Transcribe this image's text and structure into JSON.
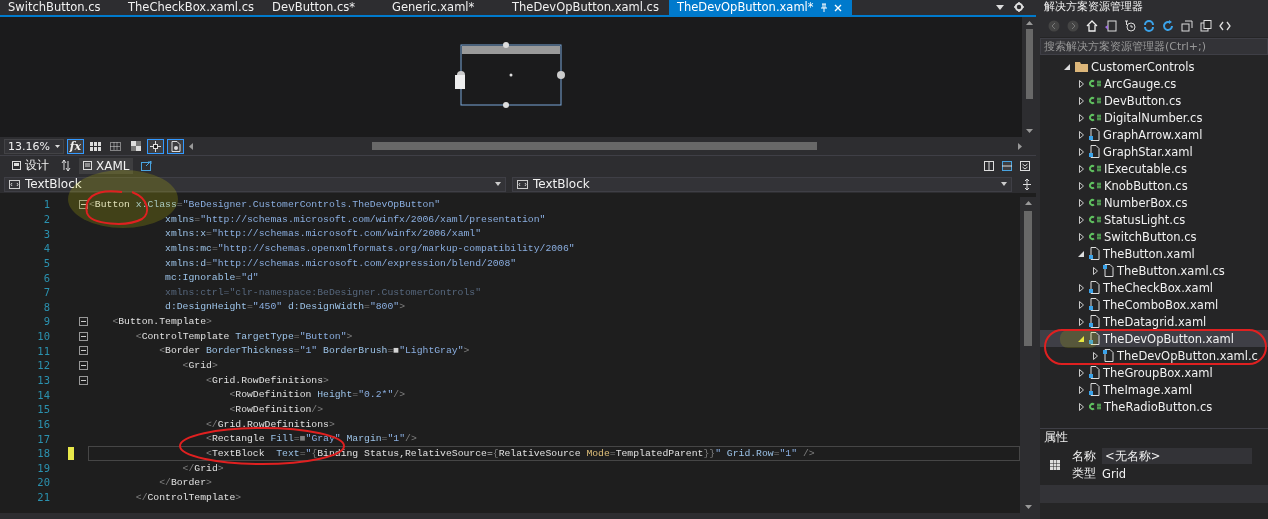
{
  "document_tabs": [
    {
      "label": "SwitchButton.cs",
      "selected": false
    },
    {
      "label": "TheCheckBox.xaml.cs",
      "selected": false
    },
    {
      "label": "DevButton.cs*",
      "selected": false
    },
    {
      "label": "Generic.xaml*",
      "selected": false
    },
    {
      "label": "TheDevOpButton.xaml.cs",
      "selected": false
    },
    {
      "label": "TheDevOpButton.xaml*",
      "selected": true
    }
  ],
  "designer": {
    "zoom": "13.16%",
    "formula_label": "fx"
  },
  "view_tabs": [
    {
      "label": "设计",
      "selected": false
    },
    {
      "label": "XAML",
      "selected": true
    }
  ],
  "navigation": {
    "left": "TextBlock",
    "right": "TextBlock"
  },
  "code_lines": [
    {
      "number": "1",
      "fold": true,
      "current": false,
      "modified": false,
      "tokens": [
        {
          "kind": "punct",
          "text": "<"
        },
        {
          "kind": "tag",
          "text": "Button"
        },
        {
          "kind": "attr",
          "text": " x:Class"
        },
        {
          "kind": "punct",
          "text": "="
        },
        {
          "kind": "value",
          "text": "\"BeDesigner.CustomerControls.TheDevOpButton\""
        }
      ]
    },
    {
      "number": "2",
      "fold": false,
      "current": false,
      "modified": false,
      "tokens": [
        {
          "kind": "attr",
          "text": "             xmlns"
        },
        {
          "kind": "punct",
          "text": "="
        },
        {
          "kind": "value",
          "text": "\"http://schemas.microsoft.com/winfx/2006/xaml/presentation\""
        }
      ]
    },
    {
      "number": "3",
      "fold": false,
      "current": false,
      "modified": false,
      "tokens": [
        {
          "kind": "attr",
          "text": "             xmlns:x"
        },
        {
          "kind": "punct",
          "text": "="
        },
        {
          "kind": "value",
          "text": "\"http://schemas.microsoft.com/winfx/2006/xaml\""
        }
      ]
    },
    {
      "number": "4",
      "fold": false,
      "current": false,
      "modified": false,
      "tokens": [
        {
          "kind": "attr",
          "text": "             xmlns:mc"
        },
        {
          "kind": "punct",
          "text": "="
        },
        {
          "kind": "value",
          "text": "\"http://schemas.openxmlformats.org/markup-compatibility/2006\""
        }
      ]
    },
    {
      "number": "5",
      "fold": false,
      "current": false,
      "modified": false,
      "tokens": [
        {
          "kind": "attr",
          "text": "             xmlns:d"
        },
        {
          "kind": "punct",
          "text": "="
        },
        {
          "kind": "value",
          "text": "\"http://schemas.microsoft.com/expression/blend/2008\""
        }
      ]
    },
    {
      "number": "6",
      "fold": false,
      "current": false,
      "modified": false,
      "tokens": [
        {
          "kind": "attr",
          "text": "             mc:Ignorable"
        },
        {
          "kind": "punct",
          "text": "="
        },
        {
          "kind": "value",
          "text": "\"d\""
        }
      ]
    },
    {
      "number": "7",
      "fold": false,
      "current": false,
      "modified": false,
      "tokens": [
        {
          "kind": "dim",
          "text": "             xmlns:ctrl=\"clr-namespace:BeDesigner.CustomerControls\""
        }
      ]
    },
    {
      "number": "8",
      "fold": false,
      "current": false,
      "modified": false,
      "tokens": [
        {
          "kind": "attr",
          "text": "             d:DesignHeight"
        },
        {
          "kind": "punct",
          "text": "="
        },
        {
          "kind": "value",
          "text": "\"450\""
        },
        {
          "kind": "attr",
          "text": " d:DesignWidth"
        },
        {
          "kind": "punct",
          "text": "="
        },
        {
          "kind": "value",
          "text": "\"800\""
        },
        {
          "kind": "punct",
          "text": ">"
        }
      ]
    },
    {
      "number": "9",
      "fold": true,
      "current": false,
      "modified": false,
      "tokens": [
        {
          "kind": "punct",
          "text": "    <"
        },
        {
          "kind": "tag",
          "text": "Button.Template"
        },
        {
          "kind": "punct",
          "text": ">"
        }
      ]
    },
    {
      "number": "10",
      "fold": true,
      "current": false,
      "modified": false,
      "tokens": [
        {
          "kind": "punct",
          "text": "        <"
        },
        {
          "kind": "tag",
          "text": "ControlTemplate"
        },
        {
          "kind": "attr",
          "text": " TargetType"
        },
        {
          "kind": "punct",
          "text": "="
        },
        {
          "kind": "value",
          "text": "\"Button\""
        },
        {
          "kind": "punct",
          "text": ">"
        }
      ]
    },
    {
      "number": "11",
      "fold": true,
      "current": false,
      "modified": false,
      "tokens": [
        {
          "kind": "punct",
          "text": "            <"
        },
        {
          "kind": "tag",
          "text": "Border"
        },
        {
          "kind": "attr",
          "text": " BorderThickness"
        },
        {
          "kind": "punct",
          "text": "="
        },
        {
          "kind": "value",
          "text": "\"1\""
        },
        {
          "kind": "attr",
          "text": " BorderBrush"
        },
        {
          "kind": "punct",
          "text": "="
        },
        {
          "kind": "swatch",
          "text": "■",
          "color": "#d3d3d3"
        },
        {
          "kind": "value",
          "text": "\"LightGray\""
        },
        {
          "kind": "punct",
          "text": ">"
        }
      ]
    },
    {
      "number": "12",
      "fold": true,
      "current": false,
      "modified": false,
      "tokens": [
        {
          "kind": "punct",
          "text": "                <"
        },
        {
          "kind": "tag",
          "text": "Grid"
        },
        {
          "kind": "punct",
          "text": ">"
        }
      ]
    },
    {
      "number": "13",
      "fold": true,
      "current": false,
      "modified": false,
      "tokens": [
        {
          "kind": "punct",
          "text": "                    <"
        },
        {
          "kind": "tag",
          "text": "Grid.RowDefinitions"
        },
        {
          "kind": "punct",
          "text": ">"
        }
      ]
    },
    {
      "number": "14",
      "fold": false,
      "current": false,
      "modified": false,
      "tokens": [
        {
          "kind": "punct",
          "text": "                        <"
        },
        {
          "kind": "tag",
          "text": "RowDefinition"
        },
        {
          "kind": "attr",
          "text": " Height"
        },
        {
          "kind": "punct",
          "text": "="
        },
        {
          "kind": "value",
          "text": "\"0.2*\""
        },
        {
          "kind": "punct",
          "text": "/>"
        }
      ]
    },
    {
      "number": "15",
      "fold": false,
      "current": false,
      "modified": false,
      "tokens": [
        {
          "kind": "punct",
          "text": "                        <"
        },
        {
          "kind": "tag",
          "text": "RowDefinition"
        },
        {
          "kind": "punct",
          "text": "/>"
        }
      ]
    },
    {
      "number": "16",
      "fold": false,
      "current": false,
      "modified": false,
      "tokens": [
        {
          "kind": "punct",
          "text": "                    </"
        },
        {
          "kind": "tag",
          "text": "Grid.RowDefinitions"
        },
        {
          "kind": "punct",
          "text": ">"
        }
      ]
    },
    {
      "number": "17",
      "fold": false,
      "current": false,
      "modified": false,
      "tokens": [
        {
          "kind": "punct",
          "text": "                    <"
        },
        {
          "kind": "tag",
          "text": "Rectangle"
        },
        {
          "kind": "attr",
          "text": " Fill"
        },
        {
          "kind": "punct",
          "text": "="
        },
        {
          "kind": "swatch",
          "text": "■",
          "color": "#808080"
        },
        {
          "kind": "value",
          "text": "\"Gray\""
        },
        {
          "kind": "attr",
          "text": " Margin"
        },
        {
          "kind": "punct",
          "text": "="
        },
        {
          "kind": "value",
          "text": "\"1\""
        },
        {
          "kind": "punct",
          "text": "/>"
        }
      ]
    },
    {
      "number": "18",
      "fold": false,
      "current": true,
      "modified": true,
      "tokens": [
        {
          "kind": "punct",
          "text": "                    <"
        },
        {
          "kind": "tag",
          "text": "TextBlock"
        },
        {
          "kind": "attr",
          "text": "  Text"
        },
        {
          "kind": "punct",
          "text": "="
        },
        {
          "kind": "value",
          "text": "\""
        },
        {
          "kind": "punct",
          "text": "{"
        },
        {
          "kind": "tag",
          "text": "Binding Status,RelativeSource="
        },
        {
          "kind": "punct",
          "text": "{"
        },
        {
          "kind": "tag",
          "text": "RelativeSource "
        },
        {
          "kind": "keyword",
          "text": "Mode"
        },
        {
          "kind": "punct",
          "text": "="
        },
        {
          "kind": "tag",
          "text": "TemplatedParent"
        },
        {
          "kind": "punct",
          "text": "}}"
        },
        {
          "kind": "value",
          "text": "\""
        },
        {
          "kind": "attr",
          "text": " Grid.Row"
        },
        {
          "kind": "punct",
          "text": "="
        },
        {
          "kind": "value",
          "text": "\"1\""
        },
        {
          "kind": "punct",
          "text": " />"
        }
      ]
    },
    {
      "number": "19",
      "fold": false,
      "current": false,
      "modified": false,
      "tokens": [
        {
          "kind": "punct",
          "text": "                </"
        },
        {
          "kind": "tag",
          "text": "Grid"
        },
        {
          "kind": "punct",
          "text": ">"
        }
      ]
    },
    {
      "number": "20",
      "fold": false,
      "current": false,
      "modified": false,
      "tokens": [
        {
          "kind": "punct",
          "text": "            </"
        },
        {
          "kind": "tag",
          "text": "Border"
        },
        {
          "kind": "punct",
          "text": ">"
        }
      ]
    },
    {
      "number": "21",
      "fold": false,
      "current": false,
      "modified": false,
      "tokens": [
        {
          "kind": "punct",
          "text": "        </"
        },
        {
          "kind": "tag",
          "text": "ControlTemplate"
        },
        {
          "kind": "punct",
          "text": ">"
        }
      ]
    }
  ],
  "solution_explorer": {
    "title": "解决方案资源管理器",
    "search_placeholder": "搜索解决方案资源管理器(Ctrl+;)",
    "tree": [
      {
        "label": "CustomerControls",
        "kind": "folder",
        "expanded": true,
        "selected": false,
        "children": [
          {
            "label": "ArcGauge.cs",
            "kind": "cs",
            "expanded": false,
            "selected": false
          },
          {
            "label": "DevButton.cs",
            "kind": "cs",
            "expanded": false,
            "selected": false
          },
          {
            "label": "DigitalNumber.cs",
            "kind": "cs",
            "expanded": false,
            "selected": false
          },
          {
            "label": "GraphArrow.xaml",
            "kind": "xaml",
            "expanded": false,
            "selected": false
          },
          {
            "label": "GraphStar.xaml",
            "kind": "xaml",
            "expanded": false,
            "selected": false
          },
          {
            "label": "IExecutable.cs",
            "kind": "cs",
            "expanded": false,
            "selected": false
          },
          {
            "label": "KnobButton.cs",
            "kind": "cs",
            "expanded": false,
            "selected": false
          },
          {
            "label": "NumberBox.cs",
            "kind": "cs",
            "expanded": false,
            "selected": false
          },
          {
            "label": "StatusLight.cs",
            "kind": "cs",
            "expanded": false,
            "selected": false
          },
          {
            "label": "SwitchButton.cs",
            "kind": "cs",
            "expanded": false,
            "selected": false
          },
          {
            "label": "TheButton.xaml",
            "kind": "xaml",
            "expanded": true,
            "selected": false,
            "children": [
              {
                "label": "TheButton.xaml.cs",
                "kind": "codebehind",
                "expanded": false,
                "selected": false
              }
            ]
          },
          {
            "label": "TheCheckBox.xaml",
            "kind": "xaml",
            "expanded": false,
            "selected": false
          },
          {
            "label": "TheComboBox.xaml",
            "kind": "xaml",
            "expanded": false,
            "selected": false
          },
          {
            "label": "TheDatagrid.xaml",
            "kind": "xaml",
            "expanded": false,
            "selected": false
          },
          {
            "label": "TheDevOpButton.xaml",
            "kind": "xaml",
            "expanded": true,
            "selected": true,
            "children": [
              {
                "label": "TheDevOpButton.xaml.c",
                "kind": "codebehind",
                "expanded": false,
                "selected": false
              }
            ]
          },
          {
            "label": "TheGroupBox.xaml",
            "kind": "xaml",
            "expanded": false,
            "selected": false
          },
          {
            "label": "TheImage.xaml",
            "kind": "xaml",
            "expanded": false,
            "selected": false
          },
          {
            "label": "TheRadioButton.cs",
            "kind": "cs",
            "expanded": false,
            "selected": false
          }
        ]
      }
    ]
  },
  "properties": {
    "title": "属性",
    "name_label": "名称",
    "name_value": "<无名称>",
    "type_label": "类型",
    "type_value": "Grid"
  }
}
